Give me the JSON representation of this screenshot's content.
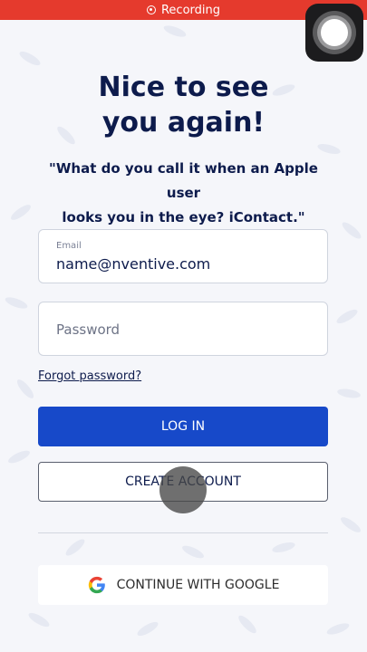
{
  "status_bar": {
    "recording_label": "Recording"
  },
  "title": {
    "line1": "Nice to see",
    "line2": "you again!"
  },
  "joke": {
    "line1": "\"What do you call it when an Apple user",
    "line2": "looks you in the eye? iContact.\""
  },
  "email_field": {
    "label": "Email",
    "value": "name@nventive.com"
  },
  "password_field": {
    "placeholder": "Password"
  },
  "forgot_link": "Forgot password?",
  "buttons": {
    "login": "LOG IN",
    "create_account": "CREATE ACCOUNT",
    "google": "CONTINUE WITH GOOGLE"
  },
  "colors": {
    "recording_bar": "#e53a2d",
    "primary": "#1749c9",
    "text": "#0d1b4c",
    "background": "#f5f6fa"
  }
}
